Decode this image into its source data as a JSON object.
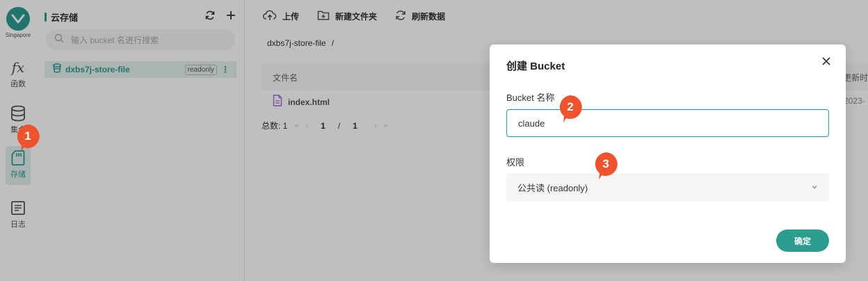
{
  "rail": {
    "region": "Singapore",
    "items": [
      {
        "label": "函数",
        "icon": "function-icon"
      },
      {
        "label": "集合",
        "icon": "database-icon"
      },
      {
        "label": "存储",
        "icon": "storage-card-icon"
      },
      {
        "label": "日志",
        "icon": "log-list-icon"
      }
    ]
  },
  "panel": {
    "title": "云存储",
    "search_placeholder": "输入 bucket 名进行搜索",
    "buckets": [
      {
        "name": "dxbs7j-store-file",
        "badge": "readonly"
      }
    ]
  },
  "toolbar": {
    "upload": "上传",
    "new_folder": "新建文件夹",
    "refresh": "刷新数据"
  },
  "path": {
    "bucket": "dxbs7j-store-file",
    "separator": "/"
  },
  "table": {
    "col_name": "文件名",
    "col_updated": "更新时",
    "rows": [
      {
        "name": "index.html",
        "updated": "2023-"
      }
    ]
  },
  "pager": {
    "total_label": "总数: 1",
    "current": "1",
    "slash": "/",
    "pages": "1"
  },
  "modal": {
    "title": "创建 Bucket",
    "name_label": "Bucket 名称",
    "name_value": "claude",
    "perm_label": "权限",
    "perm_value": "公共读 (readonly)",
    "confirm": "确定"
  },
  "markers": [
    "1",
    "2",
    "3"
  ],
  "colors": {
    "accent": "#2a9d8f",
    "marker": "#f0522d"
  }
}
